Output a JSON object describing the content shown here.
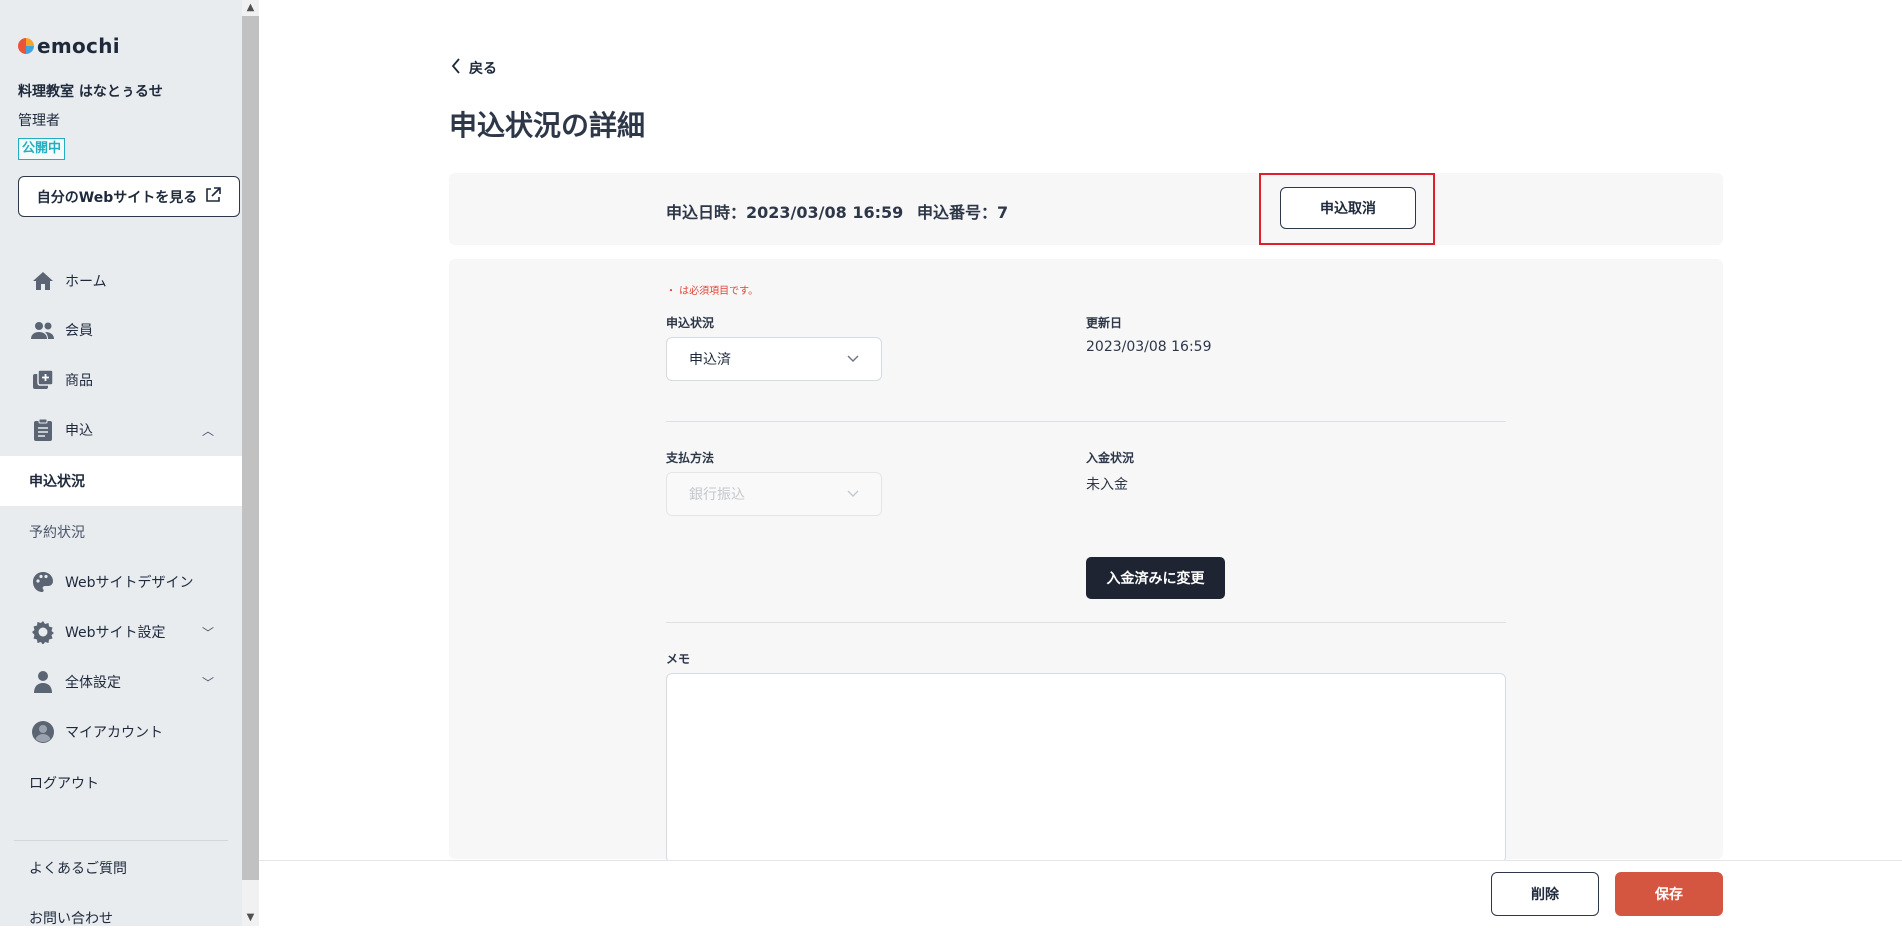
{
  "app": {
    "logo_text": "emochi"
  },
  "sidebar": {
    "school_name": "料理教室 はなとぅるせ",
    "role": "管理者",
    "status_badge": "公開中",
    "site_button": "自分のWebサイトを見る",
    "items": [
      {
        "label": "ホーム",
        "icon": "home-icon"
      },
      {
        "label": "会員",
        "icon": "members-icon"
      },
      {
        "label": "商品",
        "icon": "products-icon"
      },
      {
        "label": "申込",
        "icon": "clipboard-icon"
      },
      {
        "label": "申込状況"
      },
      {
        "label": "予約状況"
      },
      {
        "label": "Webサイトデザイン",
        "icon": "palette-icon"
      },
      {
        "label": "Webサイト設定",
        "icon": "gear-icon"
      },
      {
        "label": "全体設定",
        "icon": "person-icon"
      },
      {
        "label": "マイアカウント",
        "icon": "account-icon"
      },
      {
        "label": "ログアウト"
      }
    ],
    "faq": "よくあるご質問",
    "contact": "お問い合わせ"
  },
  "main": {
    "back": "戻る",
    "title": "申込状況の詳細",
    "info": {
      "date": "申込日時：2023/03/08 16:59",
      "number": "申込番号：7",
      "cancel_button": "申込取消"
    },
    "form": {
      "required_note": "・ は必須項目です。",
      "status_label": "申込状況",
      "status_value": "申込済",
      "updated_label": "更新日",
      "updated_value": "2023/03/08 16:59",
      "payment_method_label": "支払方法",
      "payment_method_value": "銀行振込",
      "payment_status_label": "入金状況",
      "payment_status_value": "未入金",
      "mark_paid_button": "入金済みに変更",
      "memo_label": "メモ"
    }
  },
  "footer": {
    "delete_button": "削除",
    "save_button": "保存"
  },
  "colors": {
    "sidebar_bg": "#e8ecef",
    "accent": "#d55640",
    "badge": "#22b0c0",
    "highlight": "#e01e2e",
    "dark_button": "#1f2433"
  }
}
